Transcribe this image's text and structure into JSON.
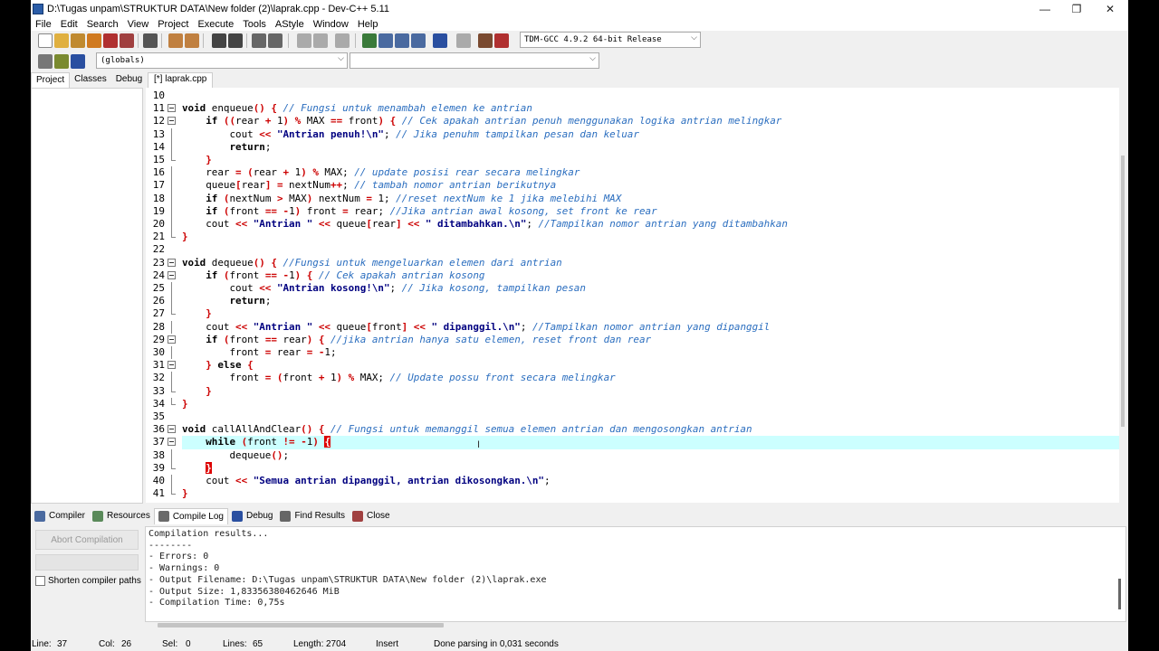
{
  "window": {
    "title": "D:\\Tugas unpam\\STRUKTUR DATA\\New folder (2)\\laprak.cpp - Dev-C++ 5.11",
    "minimize": "—",
    "maximize": "❐",
    "close": "✕"
  },
  "menu": [
    "File",
    "Edit",
    "Search",
    "View",
    "Project",
    "Execute",
    "Tools",
    "AStyle",
    "Window",
    "Help"
  ],
  "toolbar": {
    "compiler": "TDM-GCC 4.9.2 64-bit Release",
    "scope": "(globals)",
    "symbol": ""
  },
  "left_tabs": [
    "Project",
    "Classes",
    "Debug"
  ],
  "editor_tab": "[*] laprak.cpp",
  "bottom_tabs": [
    {
      "label": "Compiler",
      "icon": "grid-icon"
    },
    {
      "label": "Resources",
      "icon": "resources-icon"
    },
    {
      "label": "Compile Log",
      "icon": "chart-icon"
    },
    {
      "label": "Debug",
      "icon": "check-icon"
    },
    {
      "label": "Find Results",
      "icon": "find-icon"
    },
    {
      "label": "Close",
      "icon": "close-icon"
    }
  ],
  "compile_panel": {
    "abort": "Abort Compilation",
    "shorten": "Shorten compiler paths"
  },
  "log": [
    "Compilation results...",
    "--------",
    "- Errors: 0",
    "- Warnings: 0",
    "- Output Filename: D:\\Tugas unpam\\STRUKTUR DATA\\New folder (2)\\laprak.exe",
    "- Output Size: 1,83356380462646 MiB",
    "- Compilation Time: 0,75s"
  ],
  "status": {
    "line_label": "Line:",
    "line": "37",
    "col_label": "Col:",
    "col": "26",
    "sel_label": "Sel:",
    "sel": "0",
    "lines_label": "Lines:",
    "lines": "65",
    "length_label": "Length:",
    "length": "2704",
    "mode": "Insert",
    "message": "Done parsing in 0,031 seconds"
  },
  "lines": [
    {
      "n": "10",
      "t": ""
    },
    {
      "n": "11",
      "t": "void enqueue() { // Fungsi untuk menambah elemen ke antrian"
    },
    {
      "n": "12",
      "t": "    if ((rear + 1) % MAX == front) { // Cek apakah antrian penuh menggunakan logika antrian melingkar"
    },
    {
      "n": "13",
      "t": "        cout << \"Antrian penuh!\\n\"; // Jika penuhm tampilkan pesan dan keluar"
    },
    {
      "n": "14",
      "t": "        return;"
    },
    {
      "n": "15",
      "t": "    }"
    },
    {
      "n": "16",
      "t": "    rear = (rear + 1) % MAX; // update posisi rear secara melingkar"
    },
    {
      "n": "17",
      "t": "    queue[rear] = nextNum++; // tambah nomor antrian berikutnya"
    },
    {
      "n": "18",
      "t": "    if (nextNum > MAX) nextNum = 1; //reset nextNum ke 1 jika melebihi MAX"
    },
    {
      "n": "19",
      "t": "    if (front == -1) front = rear; //Jika antrian awal kosong, set front ke rear"
    },
    {
      "n": "20",
      "t": "    cout << \"Antrian \" << queue[rear] << \" ditambahkan.\\n\"; //Tampilkan nomor antrian yang ditambahkan"
    },
    {
      "n": "21",
      "t": "}"
    },
    {
      "n": "22",
      "t": ""
    },
    {
      "n": "23",
      "t": "void dequeue() { //Fungsi untuk mengeluarkan elemen dari antrian"
    },
    {
      "n": "24",
      "t": "    if (front == -1) { // Cek apakah antrian kosong"
    },
    {
      "n": "25",
      "t": "        cout << \"Antrian kosong!\\n\"; // Jika kosong, tampilkan pesan"
    },
    {
      "n": "26",
      "t": "        return;"
    },
    {
      "n": "27",
      "t": "    }"
    },
    {
      "n": "28",
      "t": "    cout << \"Antrian \" << queue[front] << \" dipanggil.\\n\"; //Tampilkan nomor antrian yang dipanggil"
    },
    {
      "n": "29",
      "t": "    if (front == rear) { //jika antrian hanya satu elemen, reset front dan rear"
    },
    {
      "n": "30",
      "t": "        front = rear = -1;"
    },
    {
      "n": "31",
      "t": "    } else {"
    },
    {
      "n": "32",
      "t": "        front = (front + 1) % MAX; // Update possu front secara melingkar"
    },
    {
      "n": "33",
      "t": "    }"
    },
    {
      "n": "34",
      "t": "}"
    },
    {
      "n": "35",
      "t": ""
    },
    {
      "n": "36",
      "t": "void callAllAndClear() { // Fungsi untuk memanggil semua elemen antrian dan mengosongkan antrian"
    },
    {
      "n": "37",
      "t": "    while (front != -1) {"
    },
    {
      "n": "38",
      "t": "        dequeue();"
    },
    {
      "n": "39",
      "t": "    }"
    },
    {
      "n": "40",
      "t": "    cout << \"Semua antrian dipanggil, antrian dikosongkan.\\n\";"
    },
    {
      "n": "41",
      "t": "}"
    }
  ],
  "colors": {
    "current_line": "#ccffff",
    "bracket_match": "#dd0000",
    "comment": "#2b6ebf",
    "string": "#000080",
    "operator": "#cc0000"
  }
}
